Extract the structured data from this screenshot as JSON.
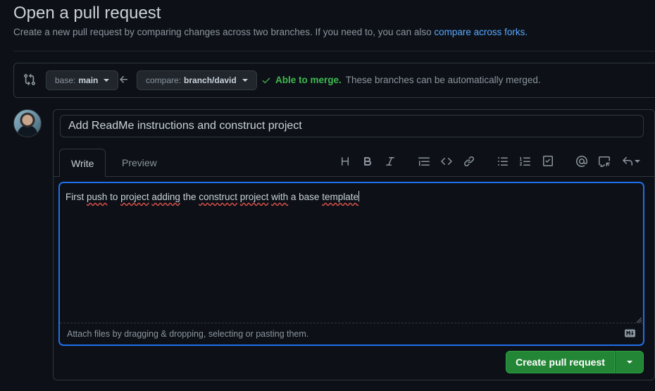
{
  "header": {
    "title": "Open a pull request",
    "subtitle": "Create a new pull request by comparing changes across two branches. If you need to, you can also",
    "compare_link": "compare across forks."
  },
  "range": {
    "base_label": "base:",
    "base_value": "main",
    "compare_label": "compare:",
    "compare_value": "branch/david",
    "merge_status": "Able to merge.",
    "merge_detail": "These branches can be automatically merged."
  },
  "form": {
    "title_value": "Add ReadMe instructions and construct project",
    "tabs": [
      {
        "label": "Write"
      },
      {
        "label": "Preview"
      }
    ],
    "body_words": {
      "w1": "First",
      "w2": "push",
      "w3": "to",
      "w4": "project",
      "w5": "adding",
      "w6": "the",
      "w7": "construct",
      "w8": "project",
      "w9": "with",
      "w10": "a",
      "w11": "base",
      "w12": "template"
    },
    "attach_hint": "Attach files by dragging & dropping, selecting or pasting them.",
    "toolbar_icons": [
      "heading-icon",
      "bold-icon",
      "italic-icon",
      "quote-icon",
      "code-icon",
      "link-icon",
      "unordered-list-icon",
      "ordered-list-icon",
      "task-list-icon",
      "mention-icon",
      "reference-icon",
      "reply-icon"
    ]
  },
  "actions": {
    "create_label": "Create pull request"
  },
  "colors": {
    "accent": "#58a6ff",
    "success": "#3fb950",
    "primary_button": "#238636",
    "focus": "#1f6feb"
  }
}
